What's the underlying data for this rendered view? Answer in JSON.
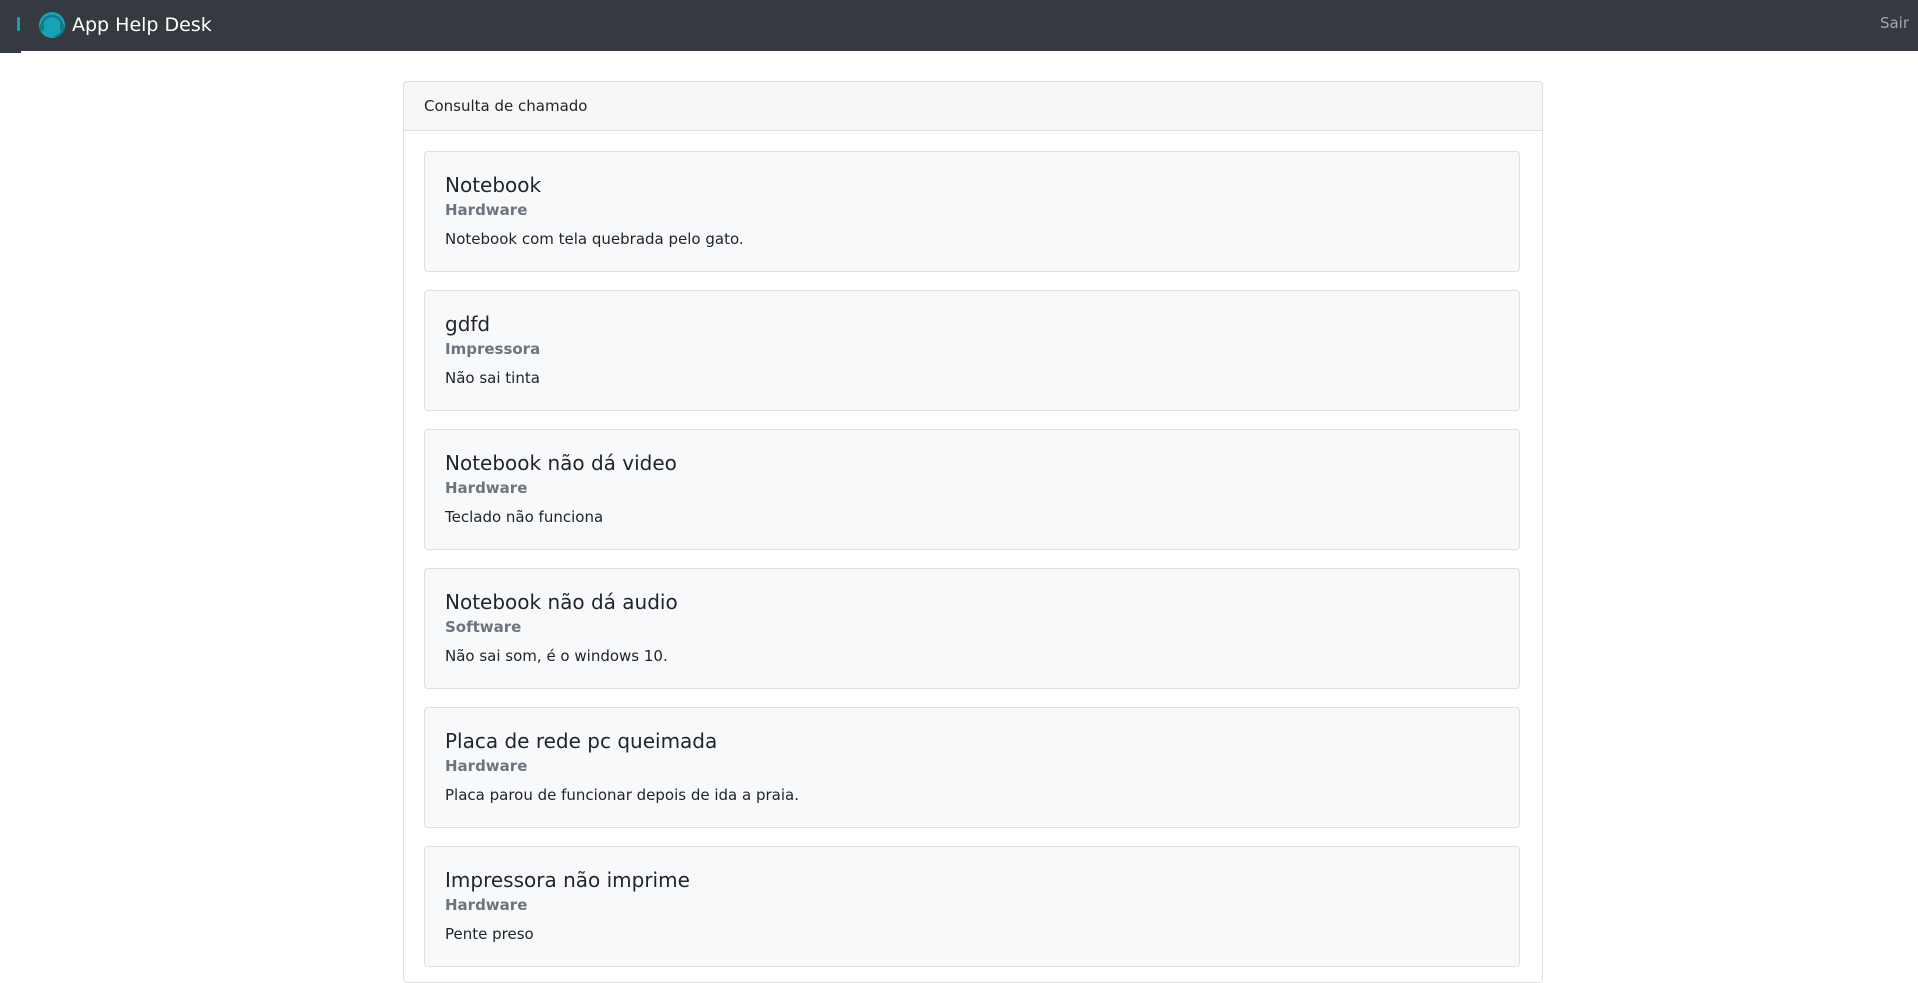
{
  "navbar": {
    "brand_title": "App Help Desk",
    "logout_label": "Sair",
    "logo_icon": "headset-logo-icon",
    "accent_color": "#17a2b8"
  },
  "main": {
    "card_header": "Consulta de chamado",
    "tickets": [
      {
        "title": "Notebook",
        "category": "Hardware",
        "description": "Notebook com tela quebrada pelo gato."
      },
      {
        "title": "gdfd",
        "category": "Impressora",
        "description": "Não sai tinta"
      },
      {
        "title": "Notebook não dá video",
        "category": "Hardware",
        "description": "Teclado não funciona"
      },
      {
        "title": "Notebook não dá audio",
        "category": "Software",
        "description": "Não sai som, é o windows 10."
      },
      {
        "title": "Placa de rede pc queimada",
        "category": "Hardware",
        "description": "Placa parou de funcionar depois de ida a praia."
      },
      {
        "title": "Impressora não imprime",
        "category": "Hardware",
        "description": "Pente preso"
      }
    ]
  }
}
